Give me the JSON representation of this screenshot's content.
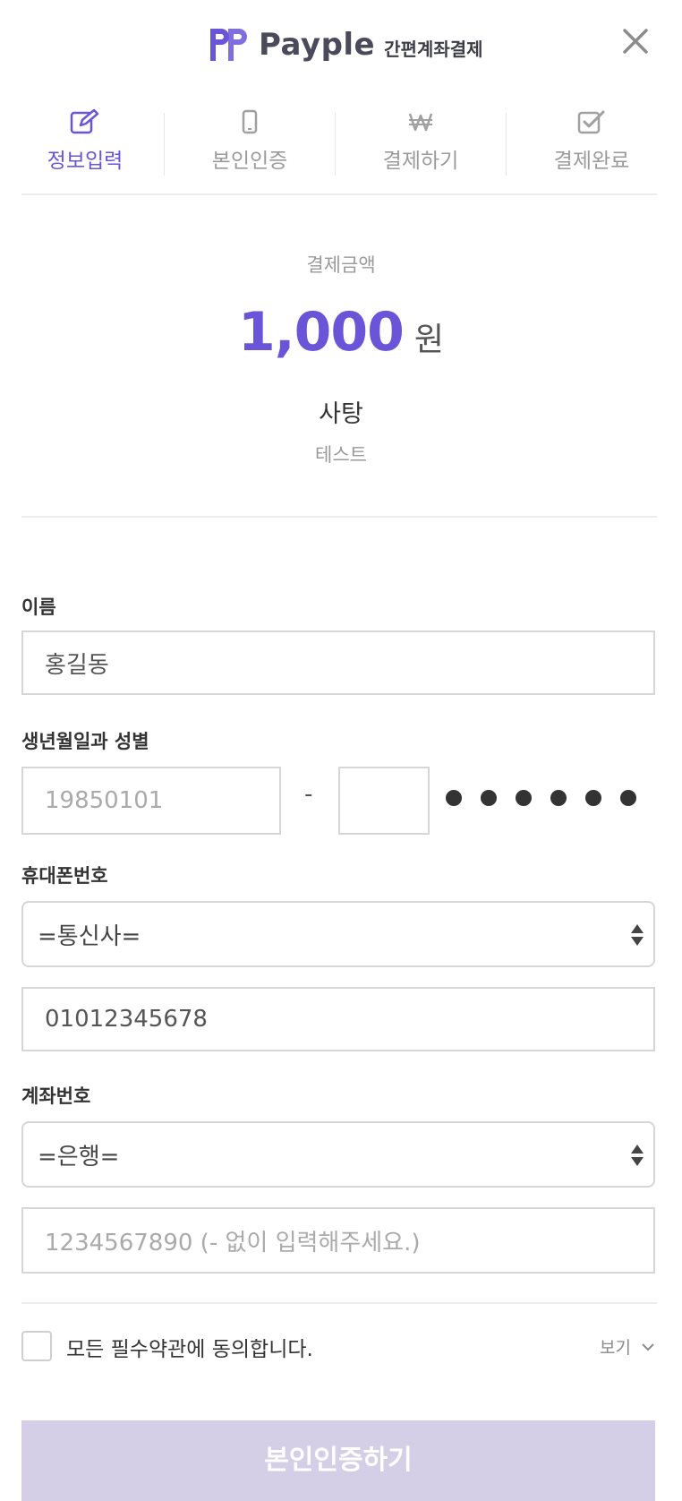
{
  "header": {
    "brand": "Payple",
    "subtitle": "간편계좌결제",
    "close_icon": "close-icon",
    "brand_color": "#6a55d8"
  },
  "steps": [
    {
      "label": "정보입력",
      "icon": "edit-icon",
      "active": true
    },
    {
      "label": "본인인증",
      "icon": "phone-icon",
      "active": false
    },
    {
      "label": "결제하기",
      "icon": "won-icon",
      "active": false
    },
    {
      "label": "결제완료",
      "icon": "check-square-icon",
      "active": false
    }
  ],
  "payment": {
    "amount_label": "결제금액",
    "amount": "1,000",
    "unit": "원",
    "product_name": "사탕",
    "product_desc": "테스트"
  },
  "form": {
    "name": {
      "label": "이름",
      "value": "홍길동"
    },
    "birth": {
      "label": "생년월일과 성별",
      "placeholder": "19850101",
      "separator": "-",
      "masked_digits": 6
    },
    "phone": {
      "label": "휴대폰번호",
      "carrier_selected": "=통신사=",
      "number_value": "01012345678"
    },
    "account": {
      "label": "계좌번호",
      "bank_selected": "=은행=",
      "number_placeholder": "1234567890 (- 없이 입력해주세요.)"
    }
  },
  "agreement": {
    "text": "모든 필수약관에 동의합니다.",
    "view_label": "보기"
  },
  "submit": {
    "label": "본인인증하기"
  }
}
